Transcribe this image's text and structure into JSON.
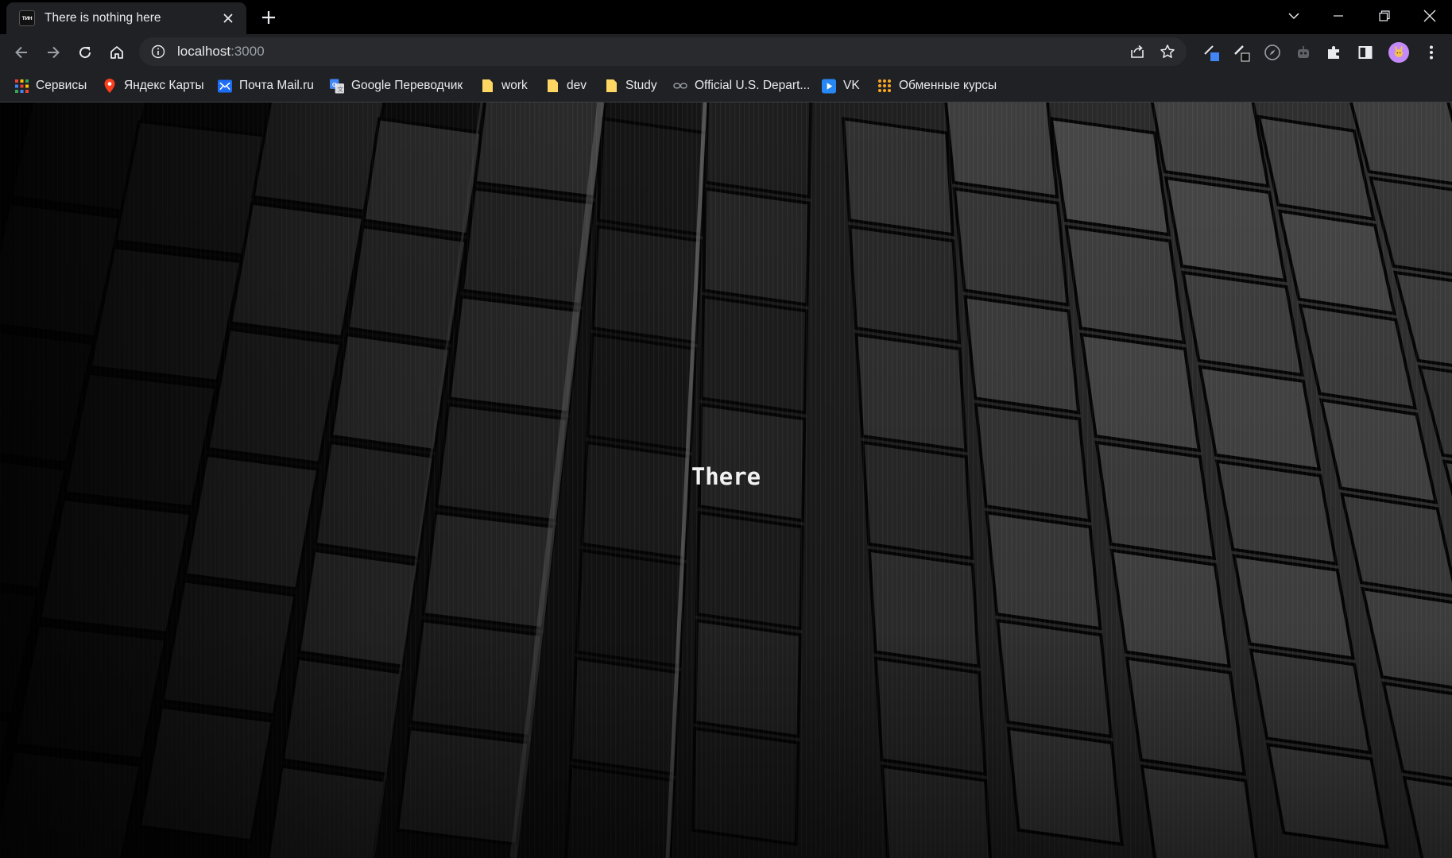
{
  "tab": {
    "title": "There is nothing here",
    "favicon_text": "ТИН",
    "favicon_icon": "tab-favicon",
    "close_icon": "close-icon"
  },
  "toolbar": {
    "url_host": "localhost",
    "url_port": ":3000"
  },
  "bookmarks": [
    {
      "label": "Сервисы",
      "icon": "apps-grid-icon"
    },
    {
      "label": "Яндекс Карты",
      "icon": "map-pin-icon"
    },
    {
      "label": "Почта Mail.ru",
      "icon": "mail-icon"
    },
    {
      "label": "Google Переводчик",
      "icon": "translate-icon"
    },
    {
      "label": "work",
      "icon": "folder-icon"
    },
    {
      "label": "dev",
      "icon": "folder-icon"
    },
    {
      "label": "Study",
      "icon": "folder-icon"
    },
    {
      "label": "Official U.S. Depart...",
      "icon": "link-icon"
    },
    {
      "label": "VK",
      "icon": "play-icon"
    },
    {
      "label": "Обменные курсы",
      "icon": "dots-grid-icon"
    }
  ],
  "page": {
    "heading": "There"
  },
  "colors": {
    "tabstrip": "#000000",
    "toolbar": "#202124",
    "omnibox": "#282a2d",
    "text": "#e8eaed",
    "muted": "#9aa0a6",
    "folder": "#fdd663",
    "avatar": "#c58af9"
  }
}
